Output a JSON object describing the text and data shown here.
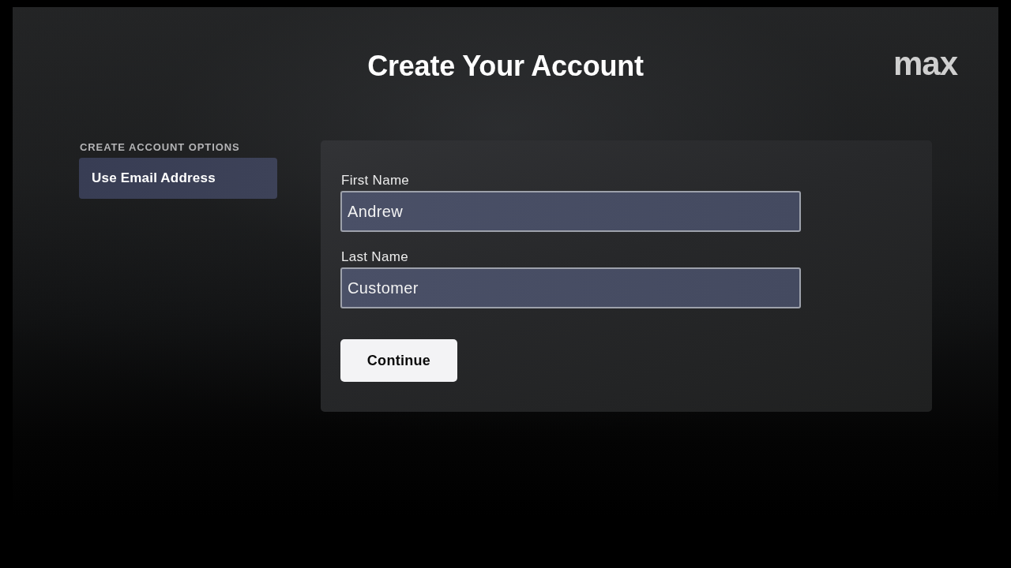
{
  "header": {
    "title": "Create Your Account",
    "logo": "max"
  },
  "sidebar": {
    "heading": "CREATE ACCOUNT OPTIONS",
    "items": [
      {
        "label": "Use Email Address",
        "selected": true
      }
    ]
  },
  "form": {
    "fields": [
      {
        "label": "First Name",
        "value": "Andrew"
      },
      {
        "label": "Last Name",
        "value": "Customer"
      }
    ],
    "button": "Continue"
  }
}
